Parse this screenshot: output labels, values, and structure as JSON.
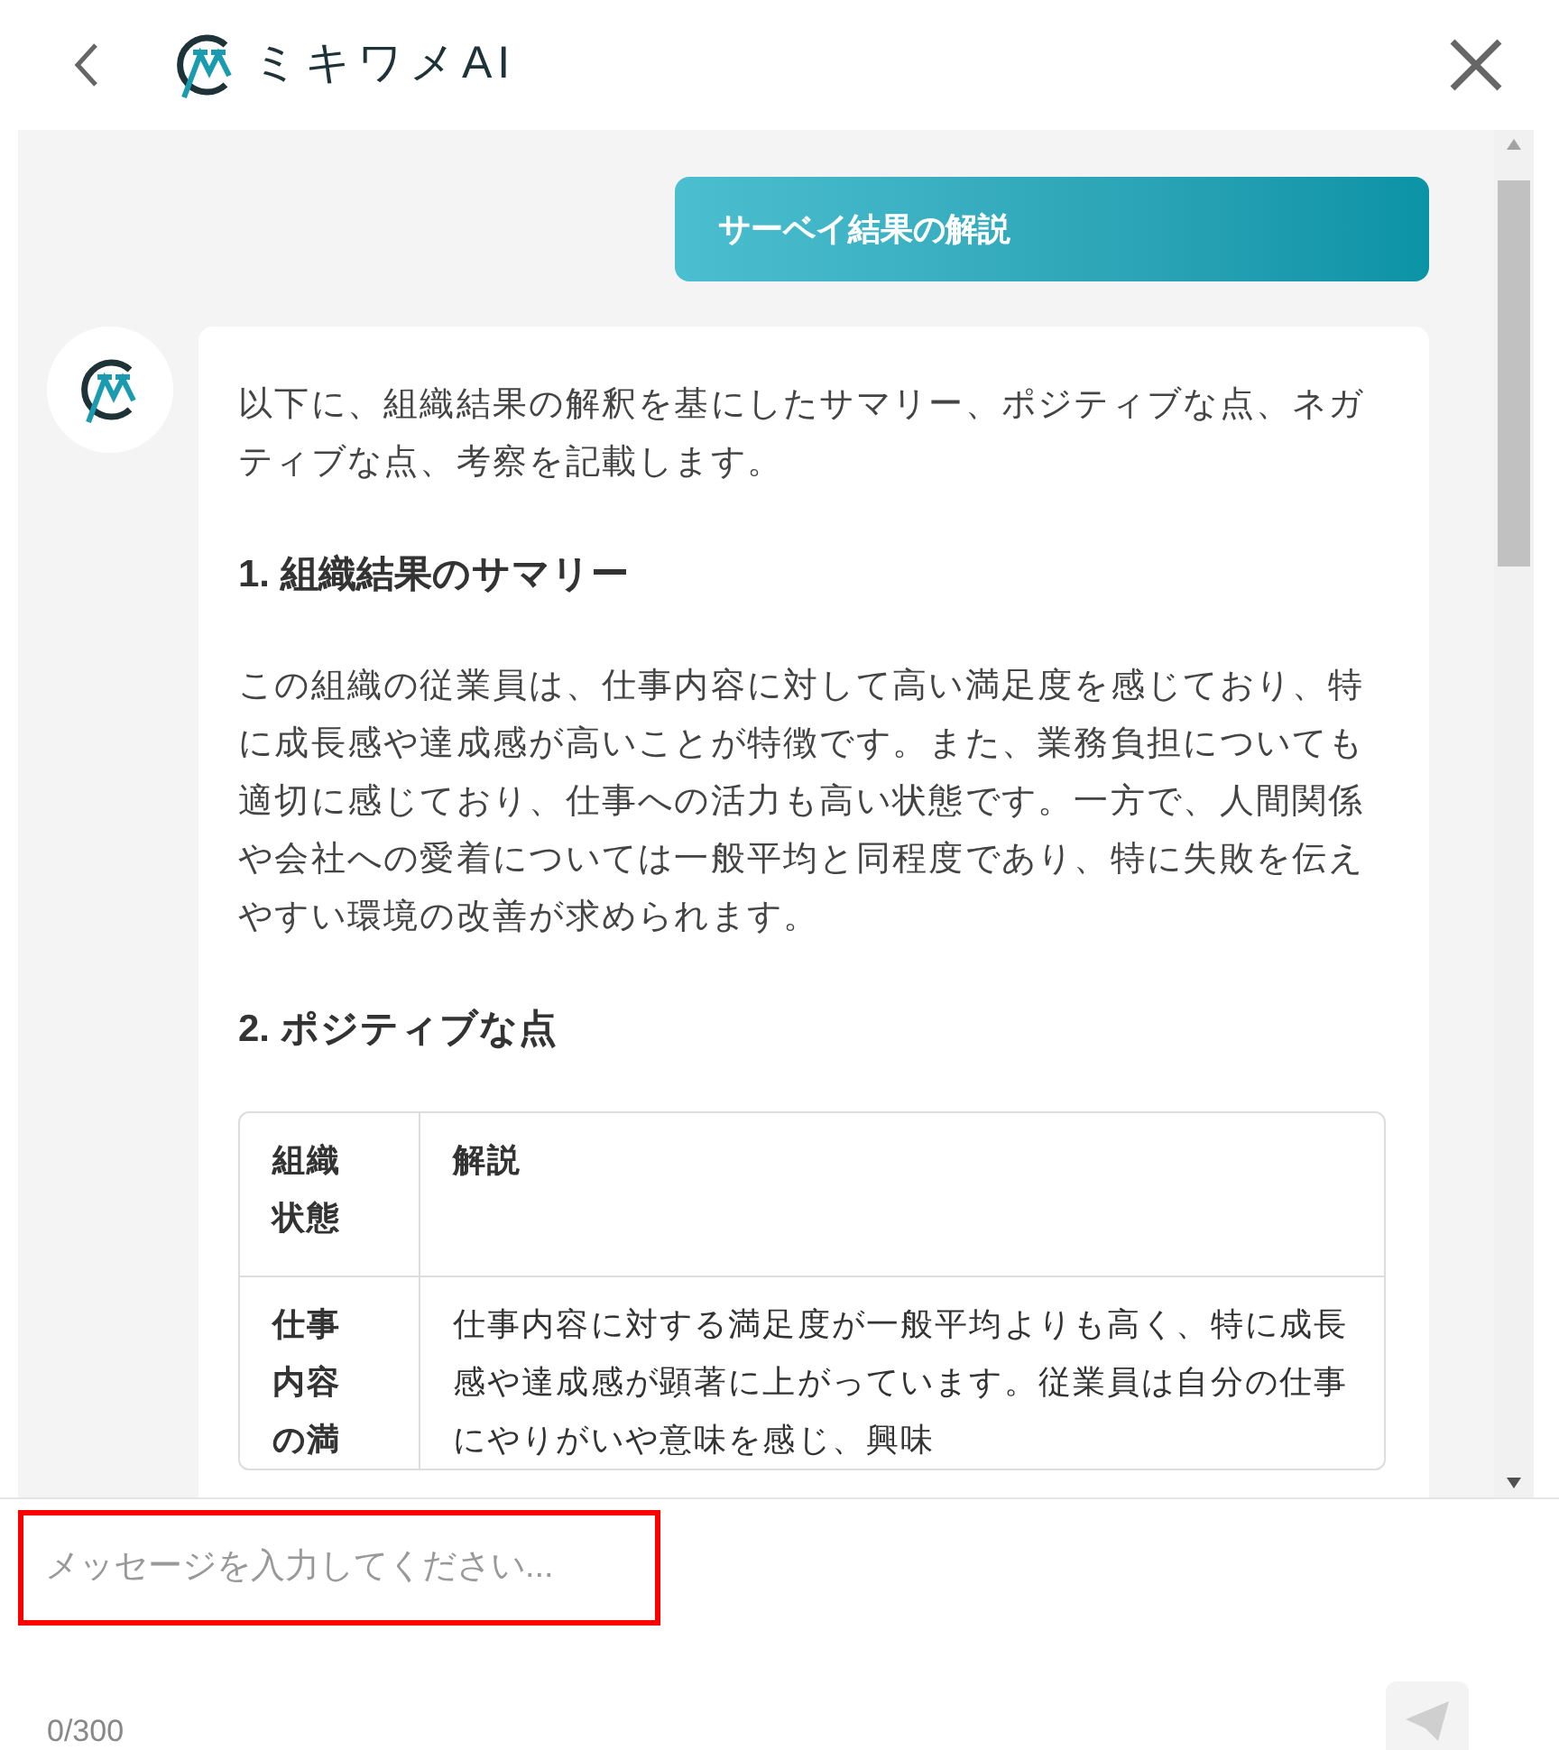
{
  "header": {
    "logo_text": "ミキワメAI"
  },
  "chat": {
    "messages": [
      {
        "kind": "user",
        "text": "サーベイ結果の解説"
      },
      {
        "kind": "bot",
        "blocks": [
          {
            "kind": "paragraph",
            "text": "以下に、組織結果の解釈を基にしたサマリー、ポジティブな点、ネガティブな点、考察を記載します。"
          },
          {
            "kind": "heading",
            "text": "1. 組織結果のサマリー"
          },
          {
            "kind": "paragraph",
            "text": "この組織の従業員は、仕事内容に対して高い満足度を感じており、特に成長感や達成感が高いことが特徴です。また、業務負担についても適切に感じており、仕事への活力も高い状態です。一方で、人間関係や会社への愛着については一般平均と同程度であり、特に失敗を伝えやすい環境の改善が求められます。"
          },
          {
            "kind": "heading",
            "text": "2. ポジティブな点"
          },
          {
            "kind": "table",
            "columns": [
              "組織状態",
              "解説"
            ],
            "rows": [
              [
                "仕事内容の満",
                "仕事内容に対する満足度が一般平均よりも高く、特に成長感や達成感が顕著に上がっています。従業員は自分の仕事にやりがいや意味を感じ、興味"
              ]
            ]
          }
        ]
      }
    ]
  },
  "composer": {
    "placeholder": "メッセージを入力してください...",
    "counter": "0/300"
  }
}
